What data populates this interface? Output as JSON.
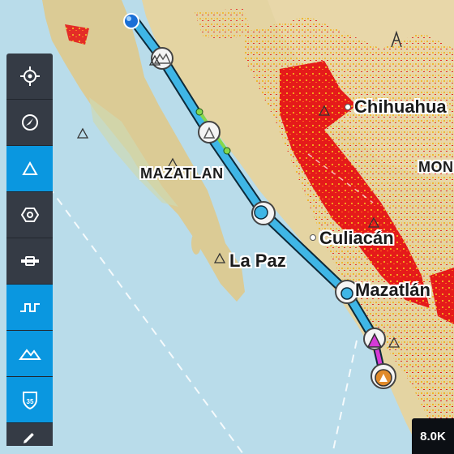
{
  "map": {
    "labels": {
      "region_baja": "MAZATLAN",
      "region_mon": "MON",
      "city_chihuahua": "Chihuahua",
      "city_culiacan": "Culiacán",
      "city_mazatlan": "Mazatlán",
      "city_lapaz": "La Paz"
    },
    "colors": {
      "water": "#b9dcea",
      "land": "#e6d8a8",
      "route": "#3fb6e6",
      "route_outline": "#0d2a3a",
      "route_active_leg": "#86d84a",
      "route_final_leg": "#d63ad6",
      "weather_heavy": "#e51a1a",
      "weather_light": "#f0b428"
    }
  },
  "toolbar": {
    "items": [
      {
        "icon": "crosshair-icon",
        "active": false
      },
      {
        "icon": "compass-icon",
        "active": false
      },
      {
        "icon": "airport-triangle-icon",
        "active": true
      },
      {
        "icon": "navaid-icon",
        "active": false
      },
      {
        "icon": "runway-icon",
        "active": false
      },
      {
        "icon": "airspace-icon",
        "active": true
      },
      {
        "icon": "terrain-icon",
        "active": true
      },
      {
        "icon": "highway-shield-icon",
        "active": true,
        "text": "35"
      },
      {
        "icon": "pencil-icon",
        "active": false
      }
    ]
  },
  "altitude_badge": "8.0K"
}
